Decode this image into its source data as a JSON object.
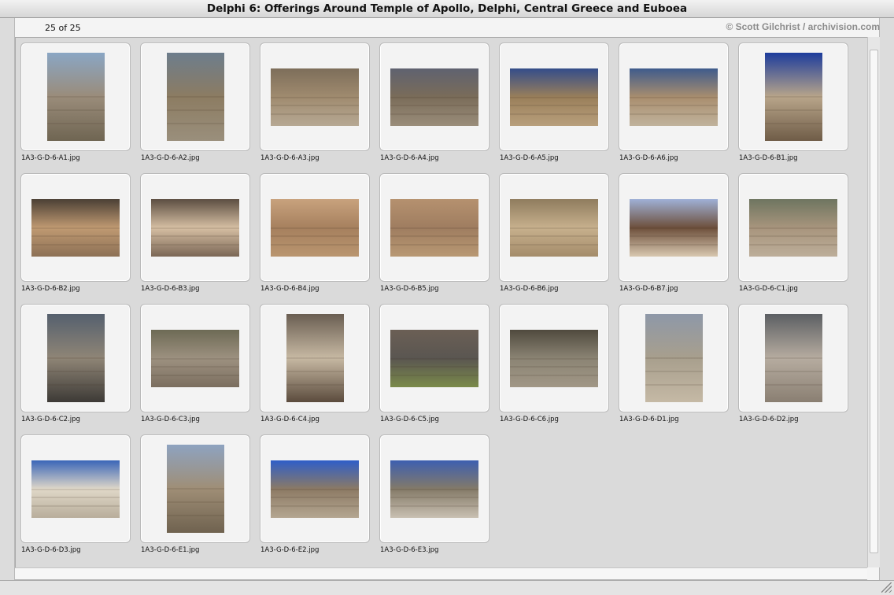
{
  "window": {
    "title": "Delphi 6: Offerings Around Temple of Apollo, Delphi, Central Greece and Euboea"
  },
  "header": {
    "count": "25 of 25",
    "copyright": "© Scott Gilchrist / archivision.com"
  },
  "thumbnails": [
    {
      "file": "1A3-G-D-6-A1.jpg",
      "orientation": "portrait",
      "colors": [
        "#8aa6c4",
        "#9a8c7a",
        "#6f6552"
      ]
    },
    {
      "file": "1A3-G-D-6-A2.jpg",
      "orientation": "portrait",
      "colors": [
        "#6d7d8c",
        "#8c7c62",
        "#9a8f7c"
      ]
    },
    {
      "file": "1A3-G-D-6-A3.jpg",
      "orientation": "landscape",
      "colors": [
        "#7d6e5a",
        "#a08b6f",
        "#b6a893"
      ]
    },
    {
      "file": "1A3-G-D-6-A4.jpg",
      "orientation": "landscape",
      "colors": [
        "#5f6270",
        "#7a6c59",
        "#9a8d7a"
      ]
    },
    {
      "file": "1A3-G-D-6-A5.jpg",
      "orientation": "landscape",
      "colors": [
        "#344d8a",
        "#9a7f5a",
        "#b89f7c"
      ]
    },
    {
      "file": "1A3-G-D-6-A6.jpg",
      "orientation": "landscape",
      "colors": [
        "#3f5b8c",
        "#a98e6e",
        "#c0b29c"
      ]
    },
    {
      "file": "1A3-G-D-6-B1.jpg",
      "orientation": "portrait",
      "colors": [
        "#1d3c9c",
        "#b8a58a",
        "#6f5c47"
      ]
    },
    {
      "file": "1A3-G-D-6-B2.jpg",
      "orientation": "landscape",
      "colors": [
        "#4b4035",
        "#c09a72",
        "#8c7055"
      ]
    },
    {
      "file": "1A3-G-D-6-B3.jpg",
      "orientation": "landscape",
      "colors": [
        "#5c4e42",
        "#d6bfa3",
        "#7a6655"
      ]
    },
    {
      "file": "1A3-G-D-6-B4.jpg",
      "orientation": "landscape",
      "colors": [
        "#c8a27d",
        "#a6805e",
        "#b9956f"
      ]
    },
    {
      "file": "1A3-G-D-6-B5.jpg",
      "orientation": "landscape",
      "colors": [
        "#b5916f",
        "#9f7d60",
        "#b89873"
      ]
    },
    {
      "file": "1A3-G-D-6-B6.jpg",
      "orientation": "landscape",
      "colors": [
        "#8f7c5e",
        "#c7b08d",
        "#a48c6a"
      ]
    },
    {
      "file": "1A3-G-D-6-B7.jpg",
      "orientation": "landscape",
      "colors": [
        "#9fb0d6",
        "#6d4f3b",
        "#d8c8b0"
      ]
    },
    {
      "file": "1A3-G-D-6-C1.jpg",
      "orientation": "landscape",
      "colors": [
        "#6e7560",
        "#a8957d",
        "#bcad99"
      ]
    },
    {
      "file": "1A3-G-D-6-C2.jpg",
      "orientation": "portrait",
      "colors": [
        "#55606e",
        "#8f8576",
        "#3d3a36"
      ]
    },
    {
      "file": "1A3-G-D-6-C3.jpg",
      "orientation": "landscape",
      "colors": [
        "#6d6a55",
        "#9d9180",
        "#7b6e5f"
      ]
    },
    {
      "file": "1A3-G-D-6-C4.jpg",
      "orientation": "portrait",
      "colors": [
        "#6a5e52",
        "#c7b9a3",
        "#5b4b3d"
      ]
    },
    {
      "file": "1A3-G-D-6-C5.jpg",
      "orientation": "landscape",
      "colors": [
        "#6b5f55",
        "#5a5651",
        "#7a8a4a"
      ]
    },
    {
      "file": "1A3-G-D-6-C6.jpg",
      "orientation": "landscape",
      "colors": [
        "#504a3e",
        "#8b8474",
        "#a19786"
      ]
    },
    {
      "file": "1A3-G-D-6-D1.jpg",
      "orientation": "portrait",
      "colors": [
        "#8e98a8",
        "#a89f8d",
        "#c5b9a5"
      ]
    },
    {
      "file": "1A3-G-D-6-D2.jpg",
      "orientation": "portrait",
      "colors": [
        "#5c5f63",
        "#b6aca0",
        "#8a7f72"
      ]
    },
    {
      "file": "1A3-G-D-6-D3.jpg",
      "orientation": "landscape",
      "colors": [
        "#3a66b8",
        "#e0d8c8",
        "#b8ad9b"
      ]
    },
    {
      "file": "1A3-G-D-6-E1.jpg",
      "orientation": "portrait",
      "colors": [
        "#8ea3c0",
        "#9f8e76",
        "#6f624f"
      ]
    },
    {
      "file": "1A3-G-D-6-E2.jpg",
      "orientation": "landscape",
      "colors": [
        "#2f5ec8",
        "#8c7a64",
        "#b4a691"
      ]
    },
    {
      "file": "1A3-G-D-6-E3.jpg",
      "orientation": "landscape",
      "colors": [
        "#3d5fb0",
        "#847a68",
        "#c9c0b2"
      ]
    }
  ]
}
